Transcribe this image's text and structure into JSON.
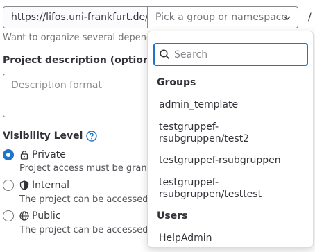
{
  "url": {
    "prefix": "https://lifos.uni-frankfurt.de/",
    "namespace_placeholder": "Pick a group or namespace",
    "separator": "/"
  },
  "form": {
    "help_text": "Want to organize several depend",
    "description_label": "Project description (optional)",
    "description_placeholder": "Description format",
    "visibility_label": "Visibility Level",
    "visibility_help_icon": "question-circle-icon",
    "options": [
      {
        "label": "Private",
        "description": "Project access must be grante",
        "icon": "lock-icon",
        "checked": true
      },
      {
        "label": "Internal",
        "description": "The project can be accessed b",
        "icon": "shield-icon",
        "checked": false
      },
      {
        "label": "Public",
        "description": "The project can be accessed v",
        "icon": "globe-icon",
        "checked": false
      }
    ]
  },
  "dropdown": {
    "search_placeholder": "Search",
    "groups_header": "Groups",
    "groups": [
      "admin_template",
      "testgruppef-rsubgruppen/test2",
      "testgruppef-rsubgruppen",
      "testgruppef-rsubgruppen/testtest"
    ],
    "users_header": "Users",
    "users": [
      "HelpAdmin"
    ]
  },
  "colors": {
    "accent": "#1f75cb",
    "text": "#333238",
    "muted": "#737278",
    "border": "#89888d"
  }
}
